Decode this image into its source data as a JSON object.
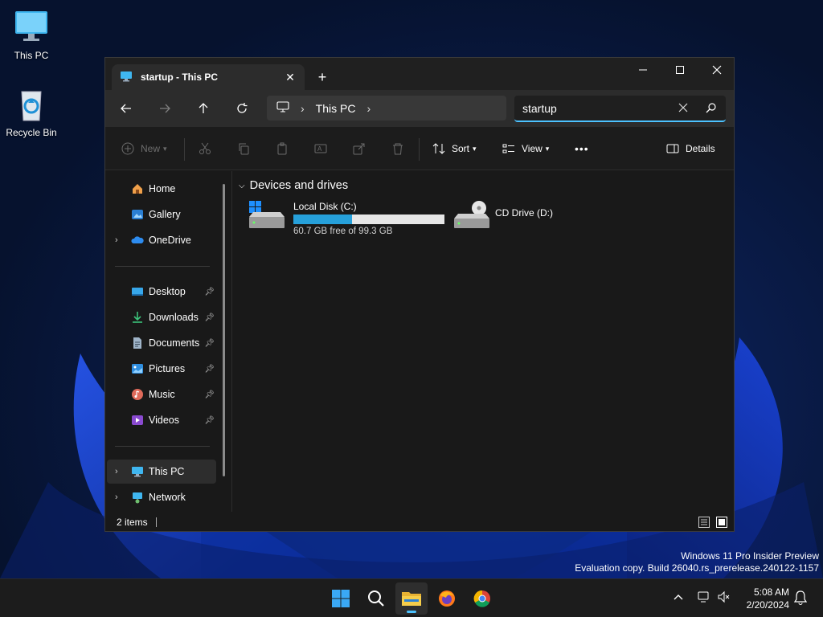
{
  "desktop": {
    "icons": [
      {
        "label": "This PC"
      },
      {
        "label": "Recycle Bin"
      }
    ],
    "watermark": {
      "line1": "Windows 11 Pro Insider Preview",
      "line2": "Evaluation copy. Build 26040.rs_prerelease.240122-1157"
    }
  },
  "window": {
    "tab": {
      "title": "startup - This PC",
      "close": "✕"
    },
    "new_tab": "+",
    "controls": {
      "minimize": "—",
      "maximize": "☐",
      "close": "✕"
    },
    "address": {
      "segments": [
        "This PC"
      ]
    },
    "search": {
      "value": "startup",
      "placeholder": ""
    },
    "toolbar": {
      "new_label": "New",
      "sort_label": "Sort",
      "view_label": "View",
      "more_label": "•••",
      "details_label": "Details"
    },
    "sidebar": {
      "items": [
        {
          "label": "Home"
        },
        {
          "label": "Gallery"
        },
        {
          "label": "OneDrive"
        },
        {
          "label": "Desktop"
        },
        {
          "label": "Downloads"
        },
        {
          "label": "Documents"
        },
        {
          "label": "Pictures"
        },
        {
          "label": "Music"
        },
        {
          "label": "Videos"
        },
        {
          "label": "This PC"
        },
        {
          "label": "Network"
        }
      ]
    },
    "content": {
      "group_title": "Devices and drives",
      "drives": [
        {
          "name": "Local Disk (C:)",
          "free_text": "60.7 GB free of 99.3 GB",
          "used_fraction": 0.389
        },
        {
          "name": "CD Drive (D:)"
        }
      ]
    },
    "status": {
      "items_count": "2 items"
    }
  },
  "taskbar": {
    "time": "5:08 AM",
    "date": "2/20/2024"
  },
  "colors": {
    "accent": "#4cc2ff",
    "drive_bar": "#26a0da",
    "window_bg": "#191919",
    "navbar_bg": "#2c2c2c"
  }
}
